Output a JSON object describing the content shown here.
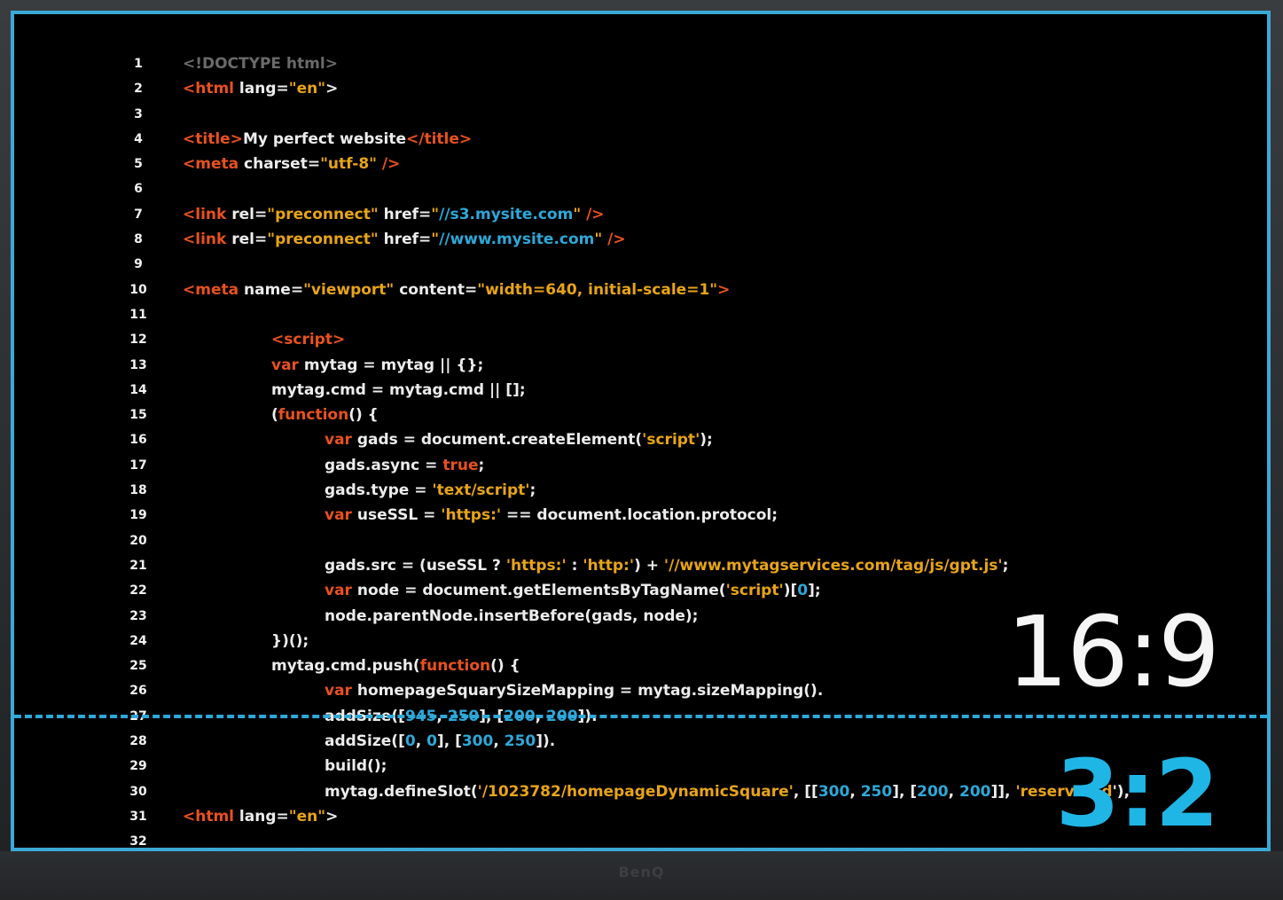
{
  "code_lines": [
    {
      "n": "1",
      "indent": 0,
      "segments": [
        {
          "t": "<!DOCTYPE html>",
          "c": "dim"
        }
      ]
    },
    {
      "n": "2",
      "indent": 0,
      "segments": [
        {
          "t": "<html",
          "c": "tag"
        },
        {
          "t": " lang=",
          "c": "plain"
        },
        {
          "t": "\"en\"",
          "c": "str"
        },
        {
          "t": ">",
          "c": "plain"
        }
      ]
    },
    {
      "n": "3",
      "indent": 0,
      "segments": []
    },
    {
      "n": "4",
      "indent": 0,
      "segments": [
        {
          "t": "<title>",
          "c": "tag"
        },
        {
          "t": "My perfect website",
          "c": "plain"
        },
        {
          "t": "</title>",
          "c": "tag"
        }
      ]
    },
    {
      "n": "5",
      "indent": 0,
      "segments": [
        {
          "t": "<meta",
          "c": "tag"
        },
        {
          "t": " charset=",
          "c": "plain"
        },
        {
          "t": "\"utf-8\"",
          "c": "str"
        },
        {
          "t": " />",
          "c": "tag"
        }
      ]
    },
    {
      "n": "6",
      "indent": 0,
      "segments": []
    },
    {
      "n": "7",
      "indent": 0,
      "segments": [
        {
          "t": "<link",
          "c": "tag"
        },
        {
          "t": " rel=",
          "c": "plain"
        },
        {
          "t": "\"preconnect\"",
          "c": "str"
        },
        {
          "t": " href=",
          "c": "plain"
        },
        {
          "t": "\"",
          "c": "str"
        },
        {
          "t": "//s3.mysite.com",
          "c": "url"
        },
        {
          "t": "\"",
          "c": "str"
        },
        {
          "t": " />",
          "c": "tag"
        }
      ]
    },
    {
      "n": "8",
      "indent": 0,
      "segments": [
        {
          "t": "<link",
          "c": "tag"
        },
        {
          "t": " rel=",
          "c": "plain"
        },
        {
          "t": "\"preconnect\"",
          "c": "str"
        },
        {
          "t": " href=",
          "c": "plain"
        },
        {
          "t": "\"",
          "c": "str"
        },
        {
          "t": "//www.mysite.com",
          "c": "url"
        },
        {
          "t": "\"",
          "c": "str"
        },
        {
          "t": " />",
          "c": "tag"
        }
      ]
    },
    {
      "n": "9",
      "indent": 0,
      "segments": []
    },
    {
      "n": "10",
      "indent": 0,
      "segments": [
        {
          "t": "<meta",
          "c": "tag"
        },
        {
          "t": " name=",
          "c": "plain"
        },
        {
          "t": "\"viewport\"",
          "c": "str"
        },
        {
          "t": " content=",
          "c": "plain"
        },
        {
          "t": "\"width=640, initial-scale=1\"",
          "c": "str"
        },
        {
          "t": ">",
          "c": "tag"
        }
      ]
    },
    {
      "n": "11",
      "indent": 0,
      "segments": []
    },
    {
      "n": "12",
      "indent": 1,
      "segments": [
        {
          "t": "<script>",
          "c": "tag"
        }
      ]
    },
    {
      "n": "13",
      "indent": 1,
      "segments": [
        {
          "t": "var",
          "c": "kw"
        },
        {
          "t": " mytag = mytag || {};",
          "c": "plain"
        }
      ]
    },
    {
      "n": "14",
      "indent": 1,
      "segments": [
        {
          "t": "mytag.cmd = mytag.cmd || [];",
          "c": "plain"
        }
      ]
    },
    {
      "n": "15",
      "indent": 1,
      "segments": [
        {
          "t": "(",
          "c": "plain"
        },
        {
          "t": "function",
          "c": "kw"
        },
        {
          "t": "() {",
          "c": "plain"
        }
      ]
    },
    {
      "n": "16",
      "indent": 2,
      "segments": [
        {
          "t": "var",
          "c": "kw"
        },
        {
          "t": " gads = document.createElement(",
          "c": "plain"
        },
        {
          "t": "'script'",
          "c": "str"
        },
        {
          "t": ");",
          "c": "plain"
        }
      ]
    },
    {
      "n": "17",
      "indent": 2,
      "segments": [
        {
          "t": "gads.async = ",
          "c": "plain"
        },
        {
          "t": "true",
          "c": "kw"
        },
        {
          "t": ";",
          "c": "plain"
        }
      ]
    },
    {
      "n": "18",
      "indent": 2,
      "segments": [
        {
          "t": "gads.type = ",
          "c": "plain"
        },
        {
          "t": "'text/script'",
          "c": "str"
        },
        {
          "t": ";",
          "c": "plain"
        }
      ]
    },
    {
      "n": "19",
      "indent": 2,
      "segments": [
        {
          "t": "var",
          "c": "kw"
        },
        {
          "t": " useSSL = ",
          "c": "plain"
        },
        {
          "t": "'https:'",
          "c": "str"
        },
        {
          "t": " == document.location.protocol;",
          "c": "plain"
        }
      ]
    },
    {
      "n": "20",
      "indent": 0,
      "segments": []
    },
    {
      "n": "21",
      "indent": 2,
      "segments": [
        {
          "t": "gads.src = (useSSL ? ",
          "c": "plain"
        },
        {
          "t": "'https:'",
          "c": "str"
        },
        {
          "t": " : ",
          "c": "plain"
        },
        {
          "t": "'http:'",
          "c": "str"
        },
        {
          "t": ") + ",
          "c": "plain"
        },
        {
          "t": "'//www.mytagservices.com/tag/js/gpt.js'",
          "c": "str"
        },
        {
          "t": ";",
          "c": "plain"
        }
      ]
    },
    {
      "n": "22",
      "indent": 2,
      "segments": [
        {
          "t": "var",
          "c": "kw"
        },
        {
          "t": " node = document.getElementsByTagName(",
          "c": "plain"
        },
        {
          "t": "'script'",
          "c": "str"
        },
        {
          "t": ")[",
          "c": "plain"
        },
        {
          "t": "0",
          "c": "num"
        },
        {
          "t": "];",
          "c": "plain"
        }
      ]
    },
    {
      "n": "23",
      "indent": 2,
      "segments": [
        {
          "t": "node.parentNode.insertBefore(gads, node);",
          "c": "plain"
        }
      ]
    },
    {
      "n": "24",
      "indent": 1,
      "segments": [
        {
          "t": "})();",
          "c": "plain"
        }
      ]
    },
    {
      "n": "25",
      "indent": 1,
      "segments": [
        {
          "t": "mytag.cmd.push(",
          "c": "plain"
        },
        {
          "t": "function",
          "c": "kw"
        },
        {
          "t": "() {",
          "c": "plain"
        }
      ]
    },
    {
      "n": "26",
      "indent": 2,
      "segments": [
        {
          "t": "var",
          "c": "kw"
        },
        {
          "t": " homepageSquarySizeMapping = mytag.sizeMapping().",
          "c": "plain"
        }
      ]
    },
    {
      "n": "27",
      "indent": 2,
      "segments": [
        {
          "t": "addSize([",
          "c": "plain"
        },
        {
          "t": "945",
          "c": "num"
        },
        {
          "t": ", ",
          "c": "plain"
        },
        {
          "t": "250",
          "c": "num"
        },
        {
          "t": "], [",
          "c": "plain"
        },
        {
          "t": "200",
          "c": "num"
        },
        {
          "t": ", ",
          "c": "plain"
        },
        {
          "t": "200",
          "c": "num"
        },
        {
          "t": "]).",
          "c": "plain"
        }
      ]
    },
    {
      "n": "28",
      "indent": 2,
      "segments": [
        {
          "t": "addSize([",
          "c": "plain"
        },
        {
          "t": "0",
          "c": "num"
        },
        {
          "t": ", ",
          "c": "plain"
        },
        {
          "t": "0",
          "c": "num"
        },
        {
          "t": "], [",
          "c": "plain"
        },
        {
          "t": "300",
          "c": "num"
        },
        {
          "t": ", ",
          "c": "plain"
        },
        {
          "t": "250",
          "c": "num"
        },
        {
          "t": "]).",
          "c": "plain"
        }
      ]
    },
    {
      "n": "29",
      "indent": 2,
      "segments": [
        {
          "t": "build();",
          "c": "plain"
        }
      ]
    },
    {
      "n": "30",
      "indent": 2,
      "segments": [
        {
          "t": "mytag.defineSlot(",
          "c": "plain"
        },
        {
          "t": "'/1023782/homepageDynamicSquare'",
          "c": "str"
        },
        {
          "t": ", [[",
          "c": "plain"
        },
        {
          "t": "300",
          "c": "num"
        },
        {
          "t": ", ",
          "c": "plain"
        },
        {
          "t": "250",
          "c": "num"
        },
        {
          "t": "], [",
          "c": "plain"
        },
        {
          "t": "200",
          "c": "num"
        },
        {
          "t": ", ",
          "c": "plain"
        },
        {
          "t": "200",
          "c": "num"
        },
        {
          "t": "]], ",
          "c": "plain"
        },
        {
          "t": "'reserved-d",
          "c": "str"
        },
        {
          "t": "'),",
          "c": "plain"
        }
      ]
    },
    {
      "n": "31",
      "indent": 0,
      "segments": [
        {
          "t": "<html",
          "c": "tag"
        },
        {
          "t": " lang=",
          "c": "plain"
        },
        {
          "t": "\"en\"",
          "c": "str"
        },
        {
          "t": ">",
          "c": "plain"
        }
      ]
    },
    {
      "n": "32",
      "indent": 0,
      "segments": []
    }
  ],
  "overlay": {
    "ratio_top": "16:9",
    "ratio_bottom": "3:2"
  },
  "monitor": {
    "brand": "BenQ"
  },
  "colors": {
    "frame": "#3aa9d6",
    "divider": "#2ea8d8",
    "tag": "#e8511f",
    "string": "#e8a418",
    "number": "#2ea8d8",
    "ratio_bottom": "#1fb6e6"
  }
}
